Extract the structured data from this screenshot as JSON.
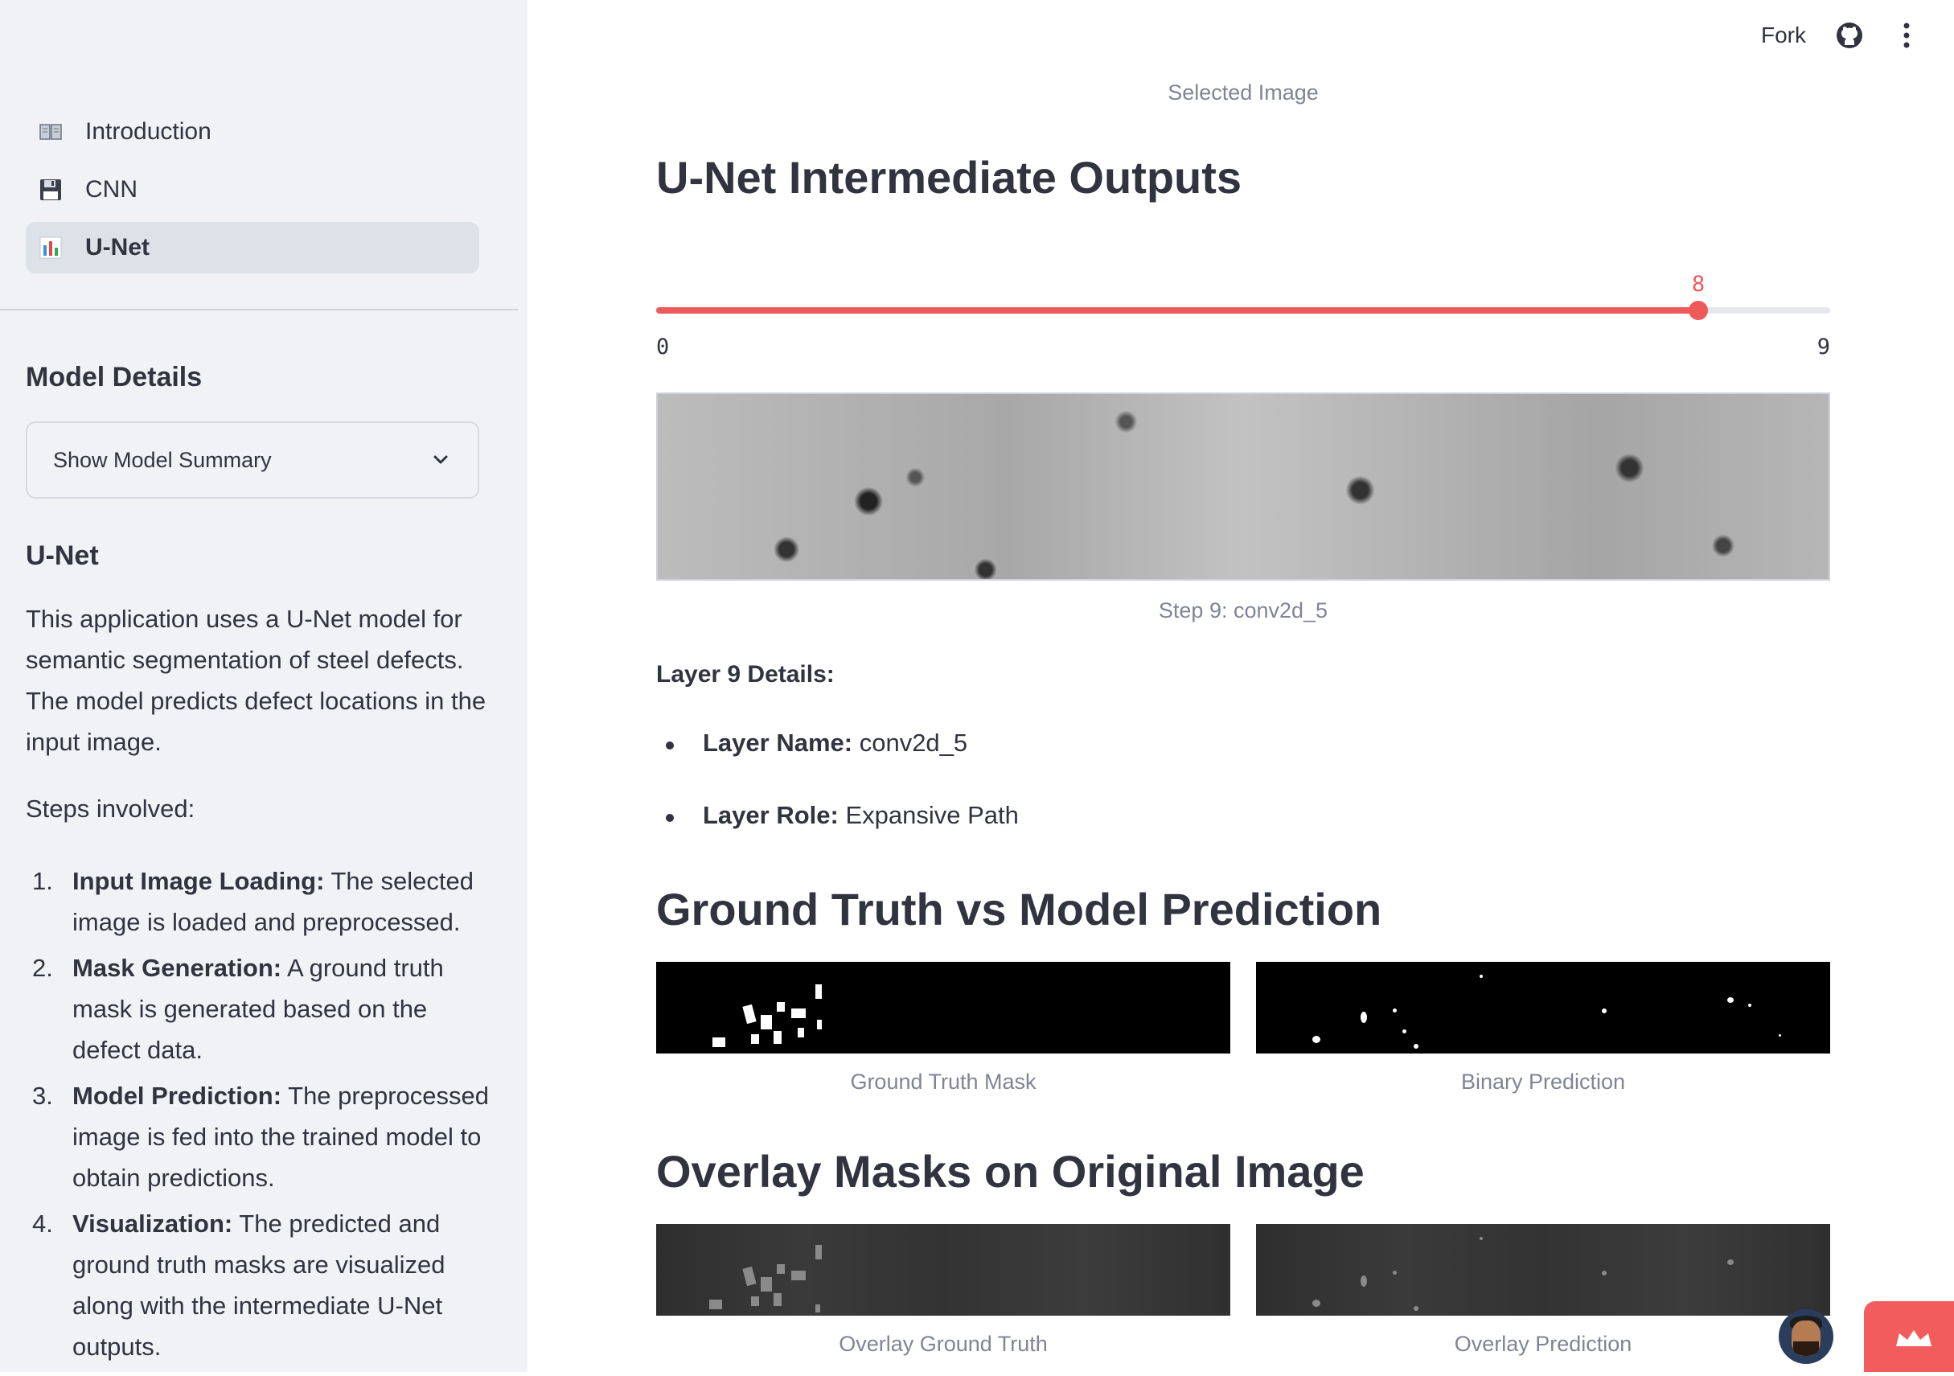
{
  "sidebar": {
    "nav": [
      {
        "label": "Introduction",
        "icon": "book-icon"
      },
      {
        "label": "CNN",
        "icon": "floppy-disk-icon"
      },
      {
        "label": "U-Net",
        "icon": "bar-chart-icon",
        "active": true
      }
    ],
    "model_details_heading": "Model Details",
    "expander_label": "Show Model Summary",
    "unet_heading": "U-Net",
    "description": "This application uses a U-Net model for semantic segmentation of steel defects. The model predicts defect locations in the input image.",
    "steps_intro": "Steps involved:",
    "steps": [
      {
        "num": "1.",
        "title": "Input Image Loading:",
        "text": " The selected image is loaded and preprocessed."
      },
      {
        "num": "2.",
        "title": "Mask Generation:",
        "text": " A ground truth mask is generated based on the defect data."
      },
      {
        "num": "3.",
        "title": "Model Prediction:",
        "text": " The preprocessed image is fed into the trained model to obtain predictions."
      },
      {
        "num": "4.",
        "title": "Visualization:",
        "text": " The predicted and ground truth masks are visualized along with the intermediate U-Net outputs."
      }
    ]
  },
  "topbar": {
    "fork_label": "Fork"
  },
  "main": {
    "selected_image_caption": "Selected Image",
    "intermediate_heading": "U-Net Intermediate Outputs",
    "slider": {
      "min": 0,
      "max": 9,
      "value": 8,
      "min_label": "0",
      "max_label": "9",
      "value_label": "8",
      "color": "#ee5a5a"
    },
    "step_caption": "Step 9: conv2d_5",
    "layer_details_label": "Layer 9 Details:",
    "layer_name_key": "Layer Name:",
    "layer_name_value": " conv2d_5",
    "layer_role_key": "Layer Role:",
    "layer_role_value": " Expansive Path",
    "gt_heading": "Ground Truth vs Model Prediction",
    "gt_caption": "Ground Truth Mask",
    "pred_caption": "Binary Prediction",
    "overlay_heading": "Overlay Masks on Original Image",
    "overlay_gt_caption": "Overlay Ground Truth",
    "overlay_pred_caption": "Overlay Prediction"
  }
}
